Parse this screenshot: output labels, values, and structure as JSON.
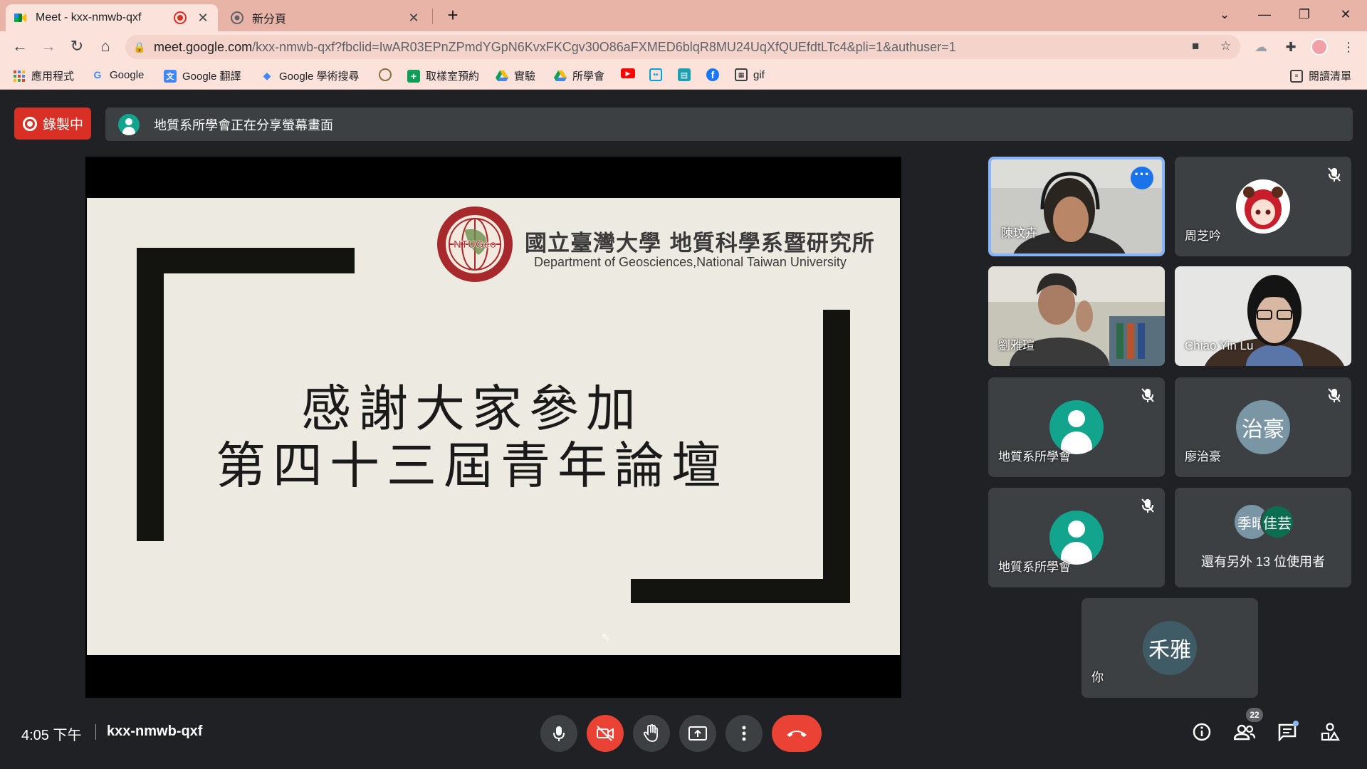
{
  "browser": {
    "tabs": [
      {
        "title": "Meet - kxx-nmwb-qxf",
        "favicon": "google-meet-icon",
        "recording": true,
        "active": true
      },
      {
        "title": "新分頁",
        "favicon": "chrome-icon",
        "recording": false,
        "active": false
      }
    ],
    "url_host": "meet.google.com",
    "url_rest": "/kxx-nmwb-qxf?fbclid=IwAR03EPnZPmdYGpN6KvxFKCgv30O86aFXMED6blqR8MU24UqXfQUEfdtLTc4&pli=1&authuser=1",
    "bookmarks": [
      {
        "label": "應用程式",
        "icon": "apps-grid-icon"
      },
      {
        "label": "Google",
        "icon": "google-g-icon"
      },
      {
        "label": "Google 翻譯",
        "icon": "translate-icon"
      },
      {
        "label": "Google 學術搜尋",
        "icon": "scholar-icon"
      },
      {
        "label": "",
        "icon": "seal-icon"
      },
      {
        "label": "取樣室預約",
        "icon": "sheets-icon"
      },
      {
        "label": "實驗",
        "icon": "drive-icon"
      },
      {
        "label": "所學會",
        "icon": "drive-icon"
      },
      {
        "label": "",
        "icon": "youtube-icon"
      },
      {
        "label": "",
        "icon": "bilibili-icon"
      },
      {
        "label": "",
        "icon": "app-icon"
      },
      {
        "label": "",
        "icon": "facebook-icon"
      },
      {
        "label": "gif",
        "icon": "gif-icon"
      }
    ],
    "reading_list": "閱讀清單"
  },
  "meet": {
    "recording_label": "錄製中",
    "share_banner": "地質系所學會正在分享螢幕畫面",
    "slide": {
      "dept_zh": "國立臺灣大學 地質科學系暨研究所",
      "dept_en": "Department of Geosciences,National Taiwan University",
      "logo_text": "NTUGeo",
      "line1": "感謝大家參加",
      "line2": "第四十三屆青年論壇"
    },
    "participants": [
      {
        "name": "陳玟卉",
        "type": "video",
        "muted": false,
        "selected": true
      },
      {
        "name": "周芝吟",
        "type": "avatar-image",
        "muted": true
      },
      {
        "name": "劉雅瑄",
        "type": "video",
        "muted": false
      },
      {
        "name": "Chiao Yin Lu",
        "type": "video",
        "muted": false
      },
      {
        "name": "地質系所學會",
        "type": "generic",
        "muted": true
      },
      {
        "name": "廖治豪",
        "type": "initials",
        "initials": "治豪",
        "color": "#7a95a3",
        "muted": true
      },
      {
        "name": "地質系所學會",
        "type": "generic",
        "muted": true
      }
    ],
    "others": {
      "avatars": [
        {
          "initials": "季晴",
          "color": "#7a95a3"
        },
        {
          "initials": "佳芸",
          "color": "#0b6e4f"
        }
      ],
      "label": "還有另外 13 位使用者"
    },
    "self_tile": {
      "name": "你",
      "initials": "禾雅",
      "color": "#3f5b66"
    },
    "bottom": {
      "time": "4:05 下午",
      "meeting_code": "kxx-nmwb-qxf",
      "people_count": "22"
    }
  }
}
